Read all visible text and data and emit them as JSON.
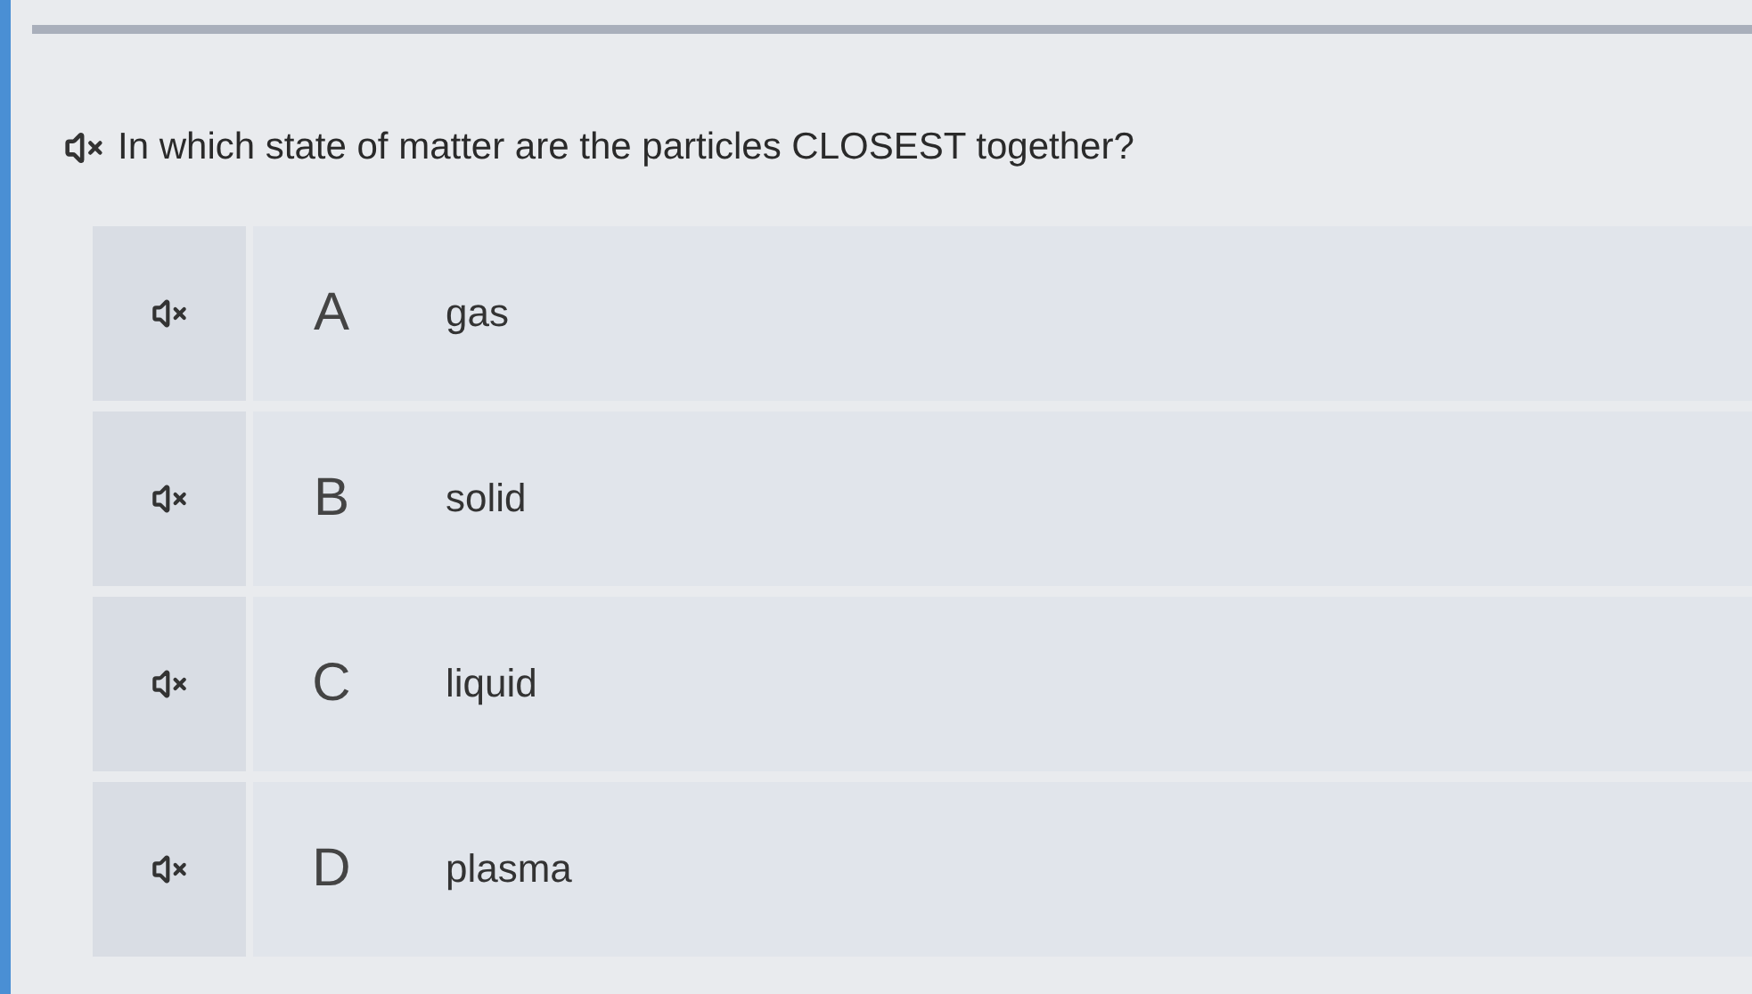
{
  "question": {
    "text": "In which state of matter are the particles CLOSEST together?"
  },
  "options": [
    {
      "letter": "A",
      "text": "gas"
    },
    {
      "letter": "B",
      "text": "solid"
    },
    {
      "letter": "C",
      "text": "liquid"
    },
    {
      "letter": "D",
      "text": "plasma"
    }
  ]
}
